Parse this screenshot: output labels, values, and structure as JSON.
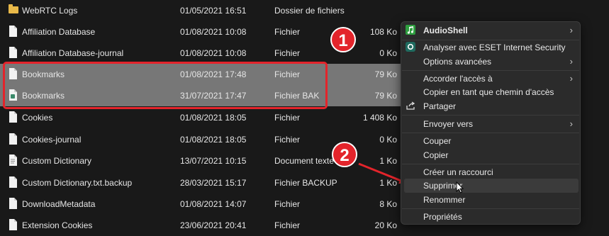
{
  "files": [
    {
      "name": "WebRTC Logs",
      "date": "01/05/2021 16:51",
      "type": "Dossier de fichiers",
      "size": "",
      "icon": "folder-icon",
      "selected": false
    },
    {
      "name": "Affiliation Database",
      "date": "01/08/2021 10:08",
      "type": "Fichier",
      "size": "108 Ko",
      "icon": "file-icon",
      "selected": false
    },
    {
      "name": "Affiliation Database-journal",
      "date": "01/08/2021 10:08",
      "type": "Fichier",
      "size": "0 Ko",
      "icon": "file-icon",
      "selected": false
    },
    {
      "name": "Bookmarks",
      "date": "01/08/2021 17:48",
      "type": "Fichier",
      "size": "79 Ko",
      "icon": "file-icon",
      "selected": true
    },
    {
      "name": "Bookmarks",
      "date": "31/07/2021 17:47",
      "type": "Fichier BAK",
      "size": "79 Ko",
      "icon": "bak-file-icon",
      "selected": true
    },
    {
      "name": "Cookies",
      "date": "01/08/2021 18:05",
      "type": "Fichier",
      "size": "1 408 Ko",
      "icon": "file-icon",
      "selected": false
    },
    {
      "name": "Cookies-journal",
      "date": "01/08/2021 18:05",
      "type": "Fichier",
      "size": "0 Ko",
      "icon": "file-icon",
      "selected": false
    },
    {
      "name": "Custom Dictionary",
      "date": "13/07/2021 10:15",
      "type": "Document texte",
      "size": "1 Ko",
      "icon": "text-file-icon",
      "selected": false
    },
    {
      "name": "Custom Dictionary.txt.backup",
      "date": "28/03/2021 15:17",
      "type": "Fichier BACKUP",
      "size": "1 Ko",
      "icon": "file-icon",
      "selected": false
    },
    {
      "name": "DownloadMetadata",
      "date": "01/08/2021 14:07",
      "type": "Fichier",
      "size": "8 Ko",
      "icon": "file-icon",
      "selected": false
    },
    {
      "name": "Extension Cookies",
      "date": "23/06/2021 20:41",
      "type": "Fichier",
      "size": "20 Ko",
      "icon": "file-icon",
      "selected": false
    }
  ],
  "context_menu": {
    "items": {
      "audioshell": "AudioShell",
      "eset_scan": "Analyser avec ESET Internet Security",
      "advanced_options": "Options avancées",
      "grant_access": "Accorder l'accès à",
      "copy_path": "Copier en tant que chemin d'accès",
      "share": "Partager",
      "send_to": "Envoyer vers",
      "cut": "Couper",
      "copy": "Copier",
      "create_shortcut": "Créer un raccourci",
      "delete": "Supprimer",
      "rename": "Renommer",
      "properties": "Propriétés"
    }
  },
  "annotations": {
    "badge1": "1",
    "badge2": "2"
  },
  "colors": {
    "callout": "#e3242b",
    "selection": "#777777",
    "background": "#191919",
    "menu": "#2b2b2b"
  }
}
